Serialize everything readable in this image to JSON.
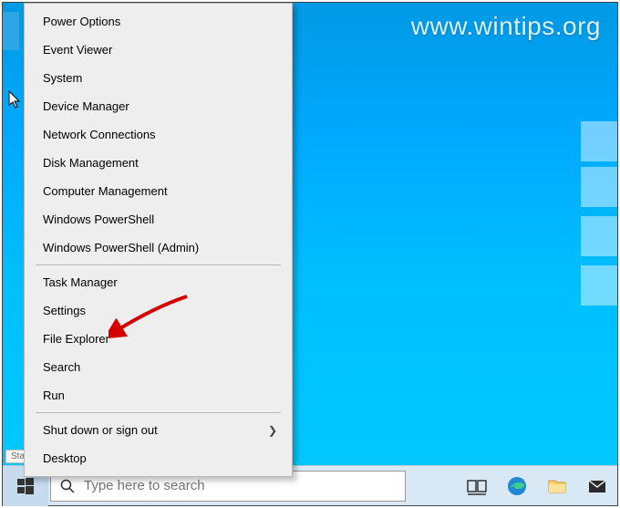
{
  "watermark": "www.wintips.org",
  "start_tooltip": "Start",
  "menu": {
    "group1": [
      {
        "label": "Power Options"
      },
      {
        "label": "Event Viewer"
      },
      {
        "label": "System"
      },
      {
        "label": "Device Manager"
      },
      {
        "label": "Network Connections"
      },
      {
        "label": "Disk Management"
      },
      {
        "label": "Computer Management"
      },
      {
        "label": "Windows PowerShell"
      },
      {
        "label": "Windows PowerShell (Admin)"
      }
    ],
    "group2": [
      {
        "label": "Task Manager"
      },
      {
        "label": "Settings"
      },
      {
        "label": "File Explorer"
      },
      {
        "label": "Search"
      },
      {
        "label": "Run"
      }
    ],
    "group3": [
      {
        "label": "Shut down or sign out",
        "submenu": true
      },
      {
        "label": "Desktop"
      }
    ]
  },
  "search": {
    "placeholder": "Type here to search"
  },
  "taskbar": {
    "icons": [
      {
        "name": "task-view-icon"
      },
      {
        "name": "edge-icon"
      },
      {
        "name": "file-explorer-icon"
      },
      {
        "name": "mail-icon"
      }
    ]
  }
}
